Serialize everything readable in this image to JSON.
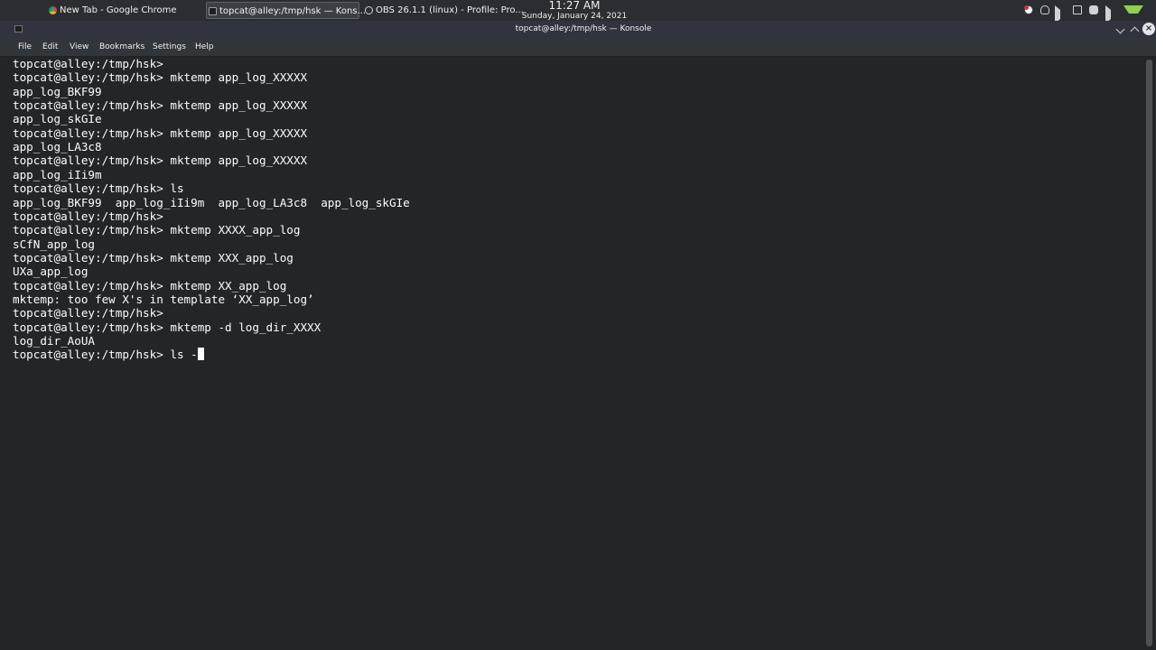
{
  "taskbar": {
    "tasks": [
      {
        "label": "New Tab - Google Chrome"
      },
      {
        "label": "topcat@alley:/tmp/hsk — Kons..."
      },
      {
        "label": "OBS 26.1.1 (linux) - Profile: Pro..."
      }
    ],
    "clock": {
      "time": "11:27 AM",
      "date": "Sunday, January 24, 2021"
    },
    "tray_icons": [
      "obs-icon",
      "bulb-icon",
      "volume-icon",
      "keyboard-icon",
      "microphone-icon",
      "speaker-icon",
      "network-icon"
    ]
  },
  "window": {
    "title": "topcat@alley:/tmp/hsk — Konsole"
  },
  "menu": {
    "items": [
      {
        "label": "File"
      },
      {
        "label": "Edit"
      },
      {
        "label": "View"
      },
      {
        "label": "Bookmarks"
      },
      {
        "label": "Settings"
      },
      {
        "label": "Help"
      }
    ]
  },
  "terminal": {
    "lines": [
      "topcat@alley:/tmp/hsk>",
      "topcat@alley:/tmp/hsk> mktemp app_log_XXXXX",
      "app_log_BKF99",
      "topcat@alley:/tmp/hsk> mktemp app_log_XXXXX",
      "app_log_skGIe",
      "topcat@alley:/tmp/hsk> mktemp app_log_XXXXX",
      "app_log_LA3c8",
      "topcat@alley:/tmp/hsk> mktemp app_log_XXXXX",
      "app_log_iIi9m",
      "topcat@alley:/tmp/hsk> ls",
      "app_log_BKF99  app_log_iIi9m  app_log_LA3c8  app_log_skGIe",
      "topcat@alley:/tmp/hsk>",
      "topcat@alley:/tmp/hsk> mktemp XXXX_app_log",
      "sCfN_app_log",
      "topcat@alley:/tmp/hsk> mktemp XXX_app_log",
      "UXa_app_log",
      "topcat@alley:/tmp/hsk> mktemp XX_app_log",
      "mktemp: too few X's in template ‘XX_app_log’",
      "topcat@alley:/tmp/hsk>",
      "topcat@alley:/tmp/hsk> mktemp -d log_dir_XXXX",
      "log_dir_AoUA",
      "topcat@alley:/tmp/hsk> ls -"
    ]
  }
}
